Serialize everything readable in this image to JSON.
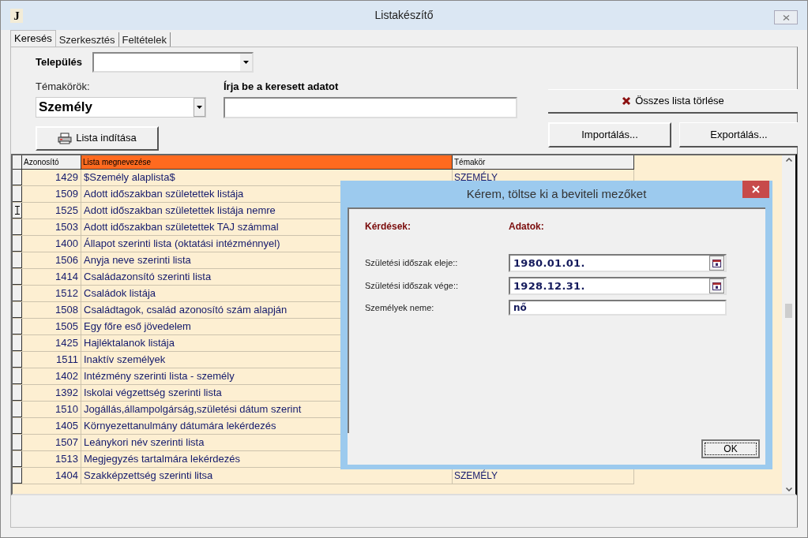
{
  "window": {
    "app_letter": "J",
    "title": "Listakészítő"
  },
  "tabs": [
    {
      "label": "Keresés",
      "selected": true
    },
    {
      "label": "Szerkesztés",
      "selected": false
    },
    {
      "label": "Feltételek",
      "selected": false
    }
  ],
  "settlement": {
    "label": "Település"
  },
  "topics": {
    "label": "Témakörök:",
    "value": "Személy"
  },
  "search": {
    "label": "Írja be a keresett adatot"
  },
  "buttons": {
    "start": "Lista indítása",
    "delete_all": "Összes lista törlése",
    "import": "Importálás...",
    "export": "Exportálás..."
  },
  "table": {
    "columns": [
      "Azonosító",
      "Lista megnevezése",
      "Témakör"
    ],
    "rows": [
      {
        "id": "1429",
        "name": "$Személy alaplista$",
        "topic": "SZEMÉLY",
        "current": false
      },
      {
        "id": "1509",
        "name": "Adott időszakban születettek listája",
        "current": false
      },
      {
        "id": "1525",
        "name": "Adott időszakban születettek listája nemre",
        "current": true
      },
      {
        "id": "1503",
        "name": "Adott időszakban születettek TAJ számmal",
        "current": false
      },
      {
        "id": "1400",
        "name": "Állapot szerinti lista (oktatási intézménnyel)",
        "current": false
      },
      {
        "id": "1506",
        "name": "Anyja neve szerinti lista",
        "current": false
      },
      {
        "id": "1414",
        "name": "Családazonsító szerinti lista",
        "current": false
      },
      {
        "id": "1512",
        "name": "Családok listája",
        "current": false
      },
      {
        "id": "1508",
        "name": "Családtagok, család azonosító szám alapján",
        "current": false
      },
      {
        "id": "1505",
        "name": "Egy főre eső jövedelem",
        "current": false
      },
      {
        "id": "1425",
        "name": "Hajléktalanok listája",
        "current": false
      },
      {
        "id": "1511",
        "name": "Inaktív személyek",
        "current": false
      },
      {
        "id": "1402",
        "name": "Intézmény szerinti lista - személy",
        "current": false
      },
      {
        "id": "1392",
        "name": "Iskolai végzettség szerinti lista",
        "current": false
      },
      {
        "id": "1510",
        "name": "Jogállás,állampolgárság,születési dátum szerint",
        "current": false
      },
      {
        "id": "1405",
        "name": "Környezettanulmány dátumára lekérdezés",
        "current": false
      },
      {
        "id": "1507",
        "name": "Leánykori név szerinti lista",
        "current": false
      },
      {
        "id": "1513",
        "name": "Megjegyzés tartalmára lekérdezés",
        "current": false
      },
      {
        "id": "1404",
        "name": "Szakképzettség szerinti litsa",
        "topic": "SZEMÉLY",
        "current": false
      }
    ]
  },
  "dialog": {
    "title": "Kérem, töltse ki a beviteli mezőket",
    "questions_header": "Kérdések:",
    "data_header": "Adatok:",
    "fields": [
      {
        "kind": "date",
        "label": "Születési időszak eleje::",
        "value": "1980.01.01."
      },
      {
        "kind": "date",
        "label": "Születési időszak vége::",
        "value": "1928.12.31."
      },
      {
        "kind": "text",
        "label": "Személyek neme:",
        "value": "nő"
      }
    ],
    "ok": "OK"
  }
}
